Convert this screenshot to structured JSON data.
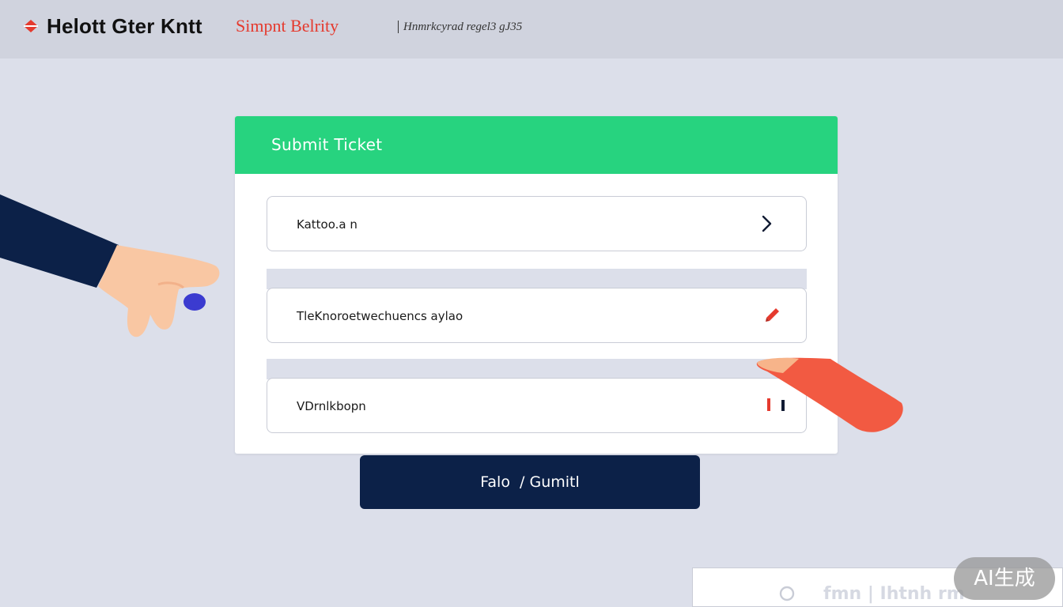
{
  "header": {
    "brand_icon": "diamond-logo-icon",
    "brand_name": "Helott Gter Kntt",
    "brand_sub": "Simpnt Belrity",
    "caption": "Hnmrkcyrad regel3 gJ35"
  },
  "form": {
    "title": "Submit Ticket",
    "fields": [
      {
        "label": "Kattoo.a n",
        "icon": "chevron-right-icon"
      },
      {
        "label": "TleKnoroetwechuencs aylao",
        "icon": "pencil-icon"
      },
      {
        "label": "VDrnlkbopn",
        "icon": "bars-icon"
      }
    ],
    "submit_label": "Falo  / Gumitl"
  },
  "footer": {
    "panel_text": "fmn | Ihtnh rm",
    "panel_icon": "circle-icon",
    "badge": "AI生成"
  },
  "colors": {
    "header_accent": "#27d37f",
    "button": "#0c2148",
    "brand_red": "#e53a2e"
  }
}
